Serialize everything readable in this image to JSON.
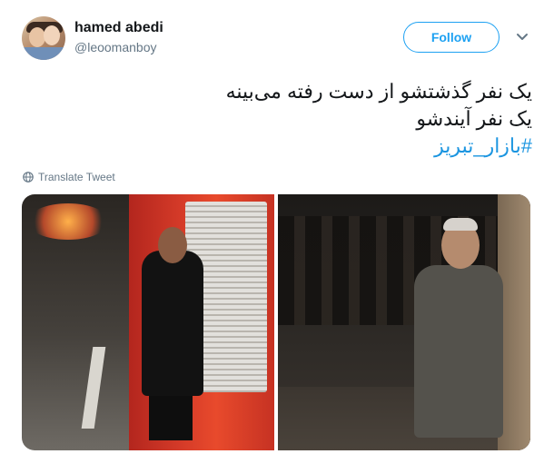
{
  "header": {
    "display_name": "hamed abedi",
    "handle": "@leoomanboy",
    "follow_label": "Follow"
  },
  "tweet": {
    "line1": "یک نفر گذشتشو از دست رفته می‌بینه",
    "line2": "یک نفر آیندشو",
    "hashtag": "#بازار_تبریز",
    "translate_label": "Translate Tweet"
  },
  "colors": {
    "accent": "#1da1f2",
    "hashtag": "#1b95e0",
    "secondary_text": "#657786"
  },
  "icons": {
    "chevron": "chevron-down-icon",
    "globe": "globe-icon"
  }
}
